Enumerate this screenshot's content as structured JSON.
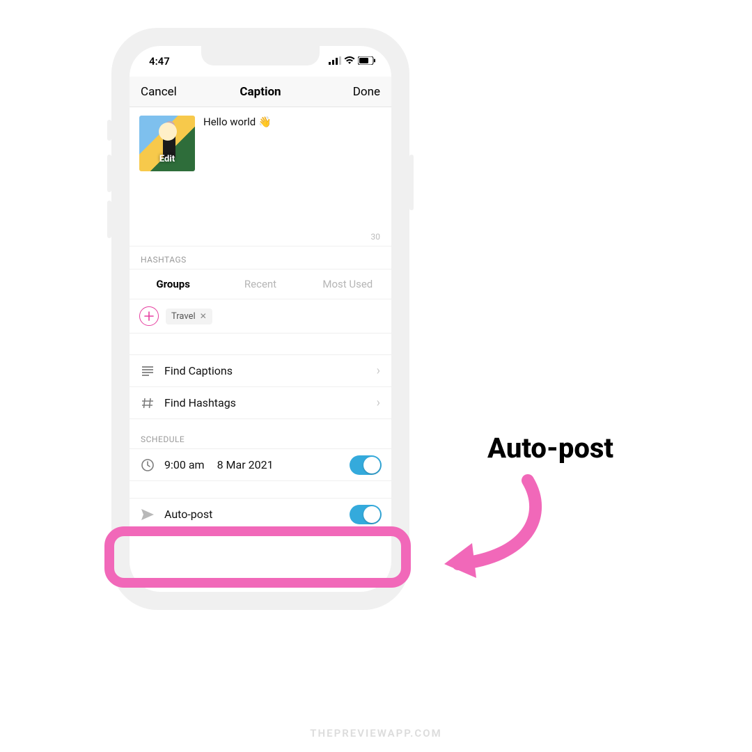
{
  "status": {
    "time": "4:47"
  },
  "nav": {
    "cancel": "Cancel",
    "title": "Caption",
    "done": "Done"
  },
  "caption": {
    "text": "Hello world 👋",
    "thumb_edit": "Edit",
    "char_count": "30"
  },
  "hashtags": {
    "label": "HASHTAGS",
    "tabs": {
      "groups": "Groups",
      "recent": "Recent",
      "most_used": "Most Used"
    },
    "chip": "Travel"
  },
  "actions": {
    "find_captions": "Find Captions",
    "find_hashtags": "Find Hashtags"
  },
  "schedule": {
    "label": "SCHEDULE",
    "time": "9:00 am",
    "date": "8 Mar 2021",
    "autopost": "Auto-post"
  },
  "annotation": "Auto-post",
  "watermark": "THEPREVIEWAPP.COM"
}
